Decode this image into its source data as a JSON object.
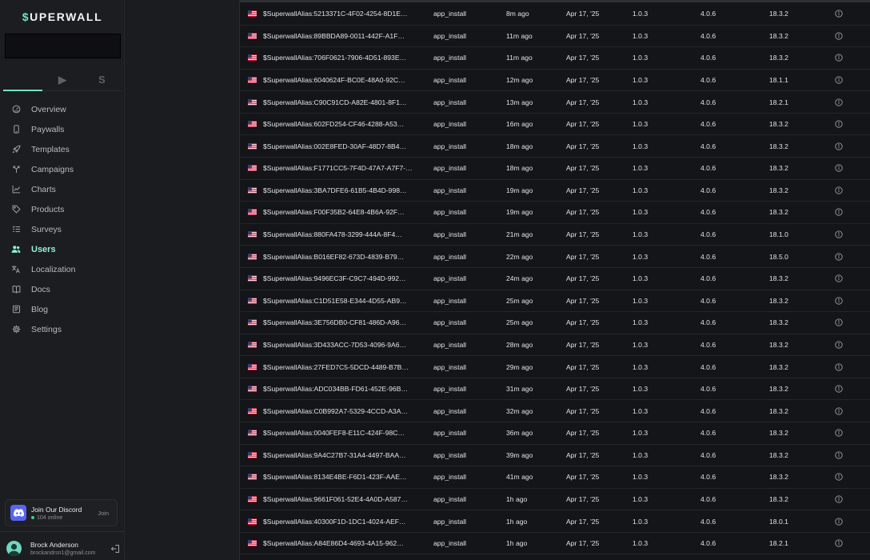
{
  "sidebar": {
    "logo_symbol": "$",
    "logo_text": "UPERWALL",
    "search_value": "",
    "platform_tabs": [
      {
        "name": "apple",
        "icon": "apple-icon",
        "glyph": "",
        "active": true
      },
      {
        "name": "android",
        "icon": "play-icon",
        "glyph": "▶",
        "active": false
      },
      {
        "name": "stripe",
        "icon": "stripe-icon",
        "glyph": "S",
        "active": false
      }
    ],
    "nav": [
      {
        "label": "Overview",
        "icon": "dashboard-icon"
      },
      {
        "label": "Paywalls",
        "icon": "phone-icon"
      },
      {
        "label": "Templates",
        "icon": "rocket-icon"
      },
      {
        "label": "Campaigns",
        "icon": "split-arrows-icon"
      },
      {
        "label": "Charts",
        "icon": "line-chart-icon"
      },
      {
        "label": "Products",
        "icon": "tag-icon"
      },
      {
        "label": "Surveys",
        "icon": "list-check-icon"
      },
      {
        "label": "Users",
        "icon": "users-icon",
        "active": true
      },
      {
        "label": "Localization",
        "icon": "translate-icon"
      },
      {
        "label": "Docs",
        "icon": "book-icon"
      },
      {
        "label": "Blog",
        "icon": "newspaper-icon"
      },
      {
        "label": "Settings",
        "icon": "gear-icon"
      }
    ],
    "discord": {
      "title": "Join Our Discord",
      "online": "104 online",
      "join_label": "Join"
    },
    "profile": {
      "name": "Brock Anderson",
      "email": "brockandrsn1@gmail.com"
    }
  },
  "colors": {
    "accent": "#6fe3c8",
    "discord": "#5865f2",
    "online_dot": "#3ecf8e"
  },
  "table": {
    "rows": [
      {
        "alias": "$SuperwallAlias:5213371C-4F02-4254-8D1E…",
        "event": "app_install",
        "time": "8m ago",
        "date": "Apr 17, '25",
        "app_version": "1.0.3",
        "sdk_version": "4.0.6",
        "os_version": "18.3.2"
      },
      {
        "alias": "$SuperwallAlias:89BBDA89-0011-442F-A1F…",
        "event": "app_install",
        "time": "11m ago",
        "date": "Apr 17, '25",
        "app_version": "1.0.3",
        "sdk_version": "4.0.6",
        "os_version": "18.3.2"
      },
      {
        "alias": "$SuperwallAlias:706F0621-7906-4D51-893E…",
        "event": "app_install",
        "time": "11m ago",
        "date": "Apr 17, '25",
        "app_version": "1.0.3",
        "sdk_version": "4.0.6",
        "os_version": "18.3.2"
      },
      {
        "alias": "$SuperwallAlias:6040624F-BC0E-48A0-92C…",
        "event": "app_install",
        "time": "12m ago",
        "date": "Apr 17, '25",
        "app_version": "1.0.3",
        "sdk_version": "4.0.6",
        "os_version": "18.1.1"
      },
      {
        "alias": "$SuperwallAlias:C90C91CD-A82E-4801-8F1…",
        "event": "app_install",
        "time": "13m ago",
        "date": "Apr 17, '25",
        "app_version": "1.0.3",
        "sdk_version": "4.0.6",
        "os_version": "18.2.1"
      },
      {
        "alias": "$SuperwallAlias:602FD254-CF46-4288-A53…",
        "event": "app_install",
        "time": "16m ago",
        "date": "Apr 17, '25",
        "app_version": "1.0.3",
        "sdk_version": "4.0.6",
        "os_version": "18.3.2"
      },
      {
        "alias": "$SuperwallAlias:002E8FED-30AF-48D7-8B4…",
        "event": "app_install",
        "time": "18m ago",
        "date": "Apr 17, '25",
        "app_version": "1.0.3",
        "sdk_version": "4.0.6",
        "os_version": "18.3.2"
      },
      {
        "alias": "$SuperwallAlias:F1771CC5-7F4D-47A7-A7F7-…",
        "event": "app_install",
        "time": "18m ago",
        "date": "Apr 17, '25",
        "app_version": "1.0.3",
        "sdk_version": "4.0.6",
        "os_version": "18.3.2"
      },
      {
        "alias": "$SuperwallAlias:3BA7DFE6-61B5-4B4D-998…",
        "event": "app_install",
        "time": "19m ago",
        "date": "Apr 17, '25",
        "app_version": "1.0.3",
        "sdk_version": "4.0.6",
        "os_version": "18.3.2"
      },
      {
        "alias": "$SuperwallAlias:F00F35B2-64E8-4B6A-92F…",
        "event": "app_install",
        "time": "19m ago",
        "date": "Apr 17, '25",
        "app_version": "1.0.3",
        "sdk_version": "4.0.6",
        "os_version": "18.3.2"
      },
      {
        "alias": "$SuperwallAlias:880FA478-3299-444A-8F4…",
        "event": "app_install",
        "time": "21m ago",
        "date": "Apr 17, '25",
        "app_version": "1.0.3",
        "sdk_version": "4.0.6",
        "os_version": "18.1.0"
      },
      {
        "alias": "$SuperwallAlias:B016EF82-673D-4839-B79…",
        "event": "app_install",
        "time": "22m ago",
        "date": "Apr 17, '25",
        "app_version": "1.0.3",
        "sdk_version": "4.0.6",
        "os_version": "18.5.0"
      },
      {
        "alias": "$SuperwallAlias:9496EC3F-C9C7-494D-992…",
        "event": "app_install",
        "time": "24m ago",
        "date": "Apr 17, '25",
        "app_version": "1.0.3",
        "sdk_version": "4.0.6",
        "os_version": "18.3.2"
      },
      {
        "alias": "$SuperwallAlias:C1D51E58-E344-4D55-AB9…",
        "event": "app_install",
        "time": "25m ago",
        "date": "Apr 17, '25",
        "app_version": "1.0.3",
        "sdk_version": "4.0.6",
        "os_version": "18.3.2"
      },
      {
        "alias": "$SuperwallAlias:3E756DB0-CF81-486D-A96…",
        "event": "app_install",
        "time": "25m ago",
        "date": "Apr 17, '25",
        "app_version": "1.0.3",
        "sdk_version": "4.0.6",
        "os_version": "18.3.2"
      },
      {
        "alias": "$SuperwallAlias:3D433ACC-7D53-4096-9A6…",
        "event": "app_install",
        "time": "28m ago",
        "date": "Apr 17, '25",
        "app_version": "1.0.3",
        "sdk_version": "4.0.6",
        "os_version": "18.3.2"
      },
      {
        "alias": "$SuperwallAlias:27FED7C5-5DCD-4489-B7B…",
        "event": "app_install",
        "time": "29m ago",
        "date": "Apr 17, '25",
        "app_version": "1.0.3",
        "sdk_version": "4.0.6",
        "os_version": "18.3.2"
      },
      {
        "alias": "$SuperwallAlias:ADC034BB-FD61-452E-96B…",
        "event": "app_install",
        "time": "31m ago",
        "date": "Apr 17, '25",
        "app_version": "1.0.3",
        "sdk_version": "4.0.6",
        "os_version": "18.3.2"
      },
      {
        "alias": "$SuperwallAlias:C0B992A7-5329-4CCD-A3A…",
        "event": "app_install",
        "time": "32m ago",
        "date": "Apr 17, '25",
        "app_version": "1.0.3",
        "sdk_version": "4.0.6",
        "os_version": "18.3.2"
      },
      {
        "alias": "$SuperwallAlias:0040FEF8-E11C-424F-98C…",
        "event": "app_install",
        "time": "36m ago",
        "date": "Apr 17, '25",
        "app_version": "1.0.3",
        "sdk_version": "4.0.6",
        "os_version": "18.3.2"
      },
      {
        "alias": "$SuperwallAlias:9A4C27B7-31A4-4497-BAA…",
        "event": "app_install",
        "time": "39m ago",
        "date": "Apr 17, '25",
        "app_version": "1.0.3",
        "sdk_version": "4.0.6",
        "os_version": "18.3.2"
      },
      {
        "alias": "$SuperwallAlias:8134E4BE-F6D1-423F-AAE…",
        "event": "app_install",
        "time": "41m ago",
        "date": "Apr 17, '25",
        "app_version": "1.0.3",
        "sdk_version": "4.0.6",
        "os_version": "18.3.2"
      },
      {
        "alias": "$SuperwallAlias:9661F061-52E4-4A0D-A587…",
        "event": "app_install",
        "time": "1h ago",
        "date": "Apr 17, '25",
        "app_version": "1.0.3",
        "sdk_version": "4.0.6",
        "os_version": "18.3.2"
      },
      {
        "alias": "$SuperwallAlias:40300F1D-1DC1-4024-AEF…",
        "event": "app_install",
        "time": "1h ago",
        "date": "Apr 17, '25",
        "app_version": "1.0.3",
        "sdk_version": "4.0.6",
        "os_version": "18.0.1"
      },
      {
        "alias": "$SuperwallAlias:A84E86D4-4693-4A15-962…",
        "event": "app_install",
        "time": "1h ago",
        "date": "Apr 17, '25",
        "app_version": "1.0.3",
        "sdk_version": "4.0.6",
        "os_version": "18.2.1"
      }
    ]
  }
}
